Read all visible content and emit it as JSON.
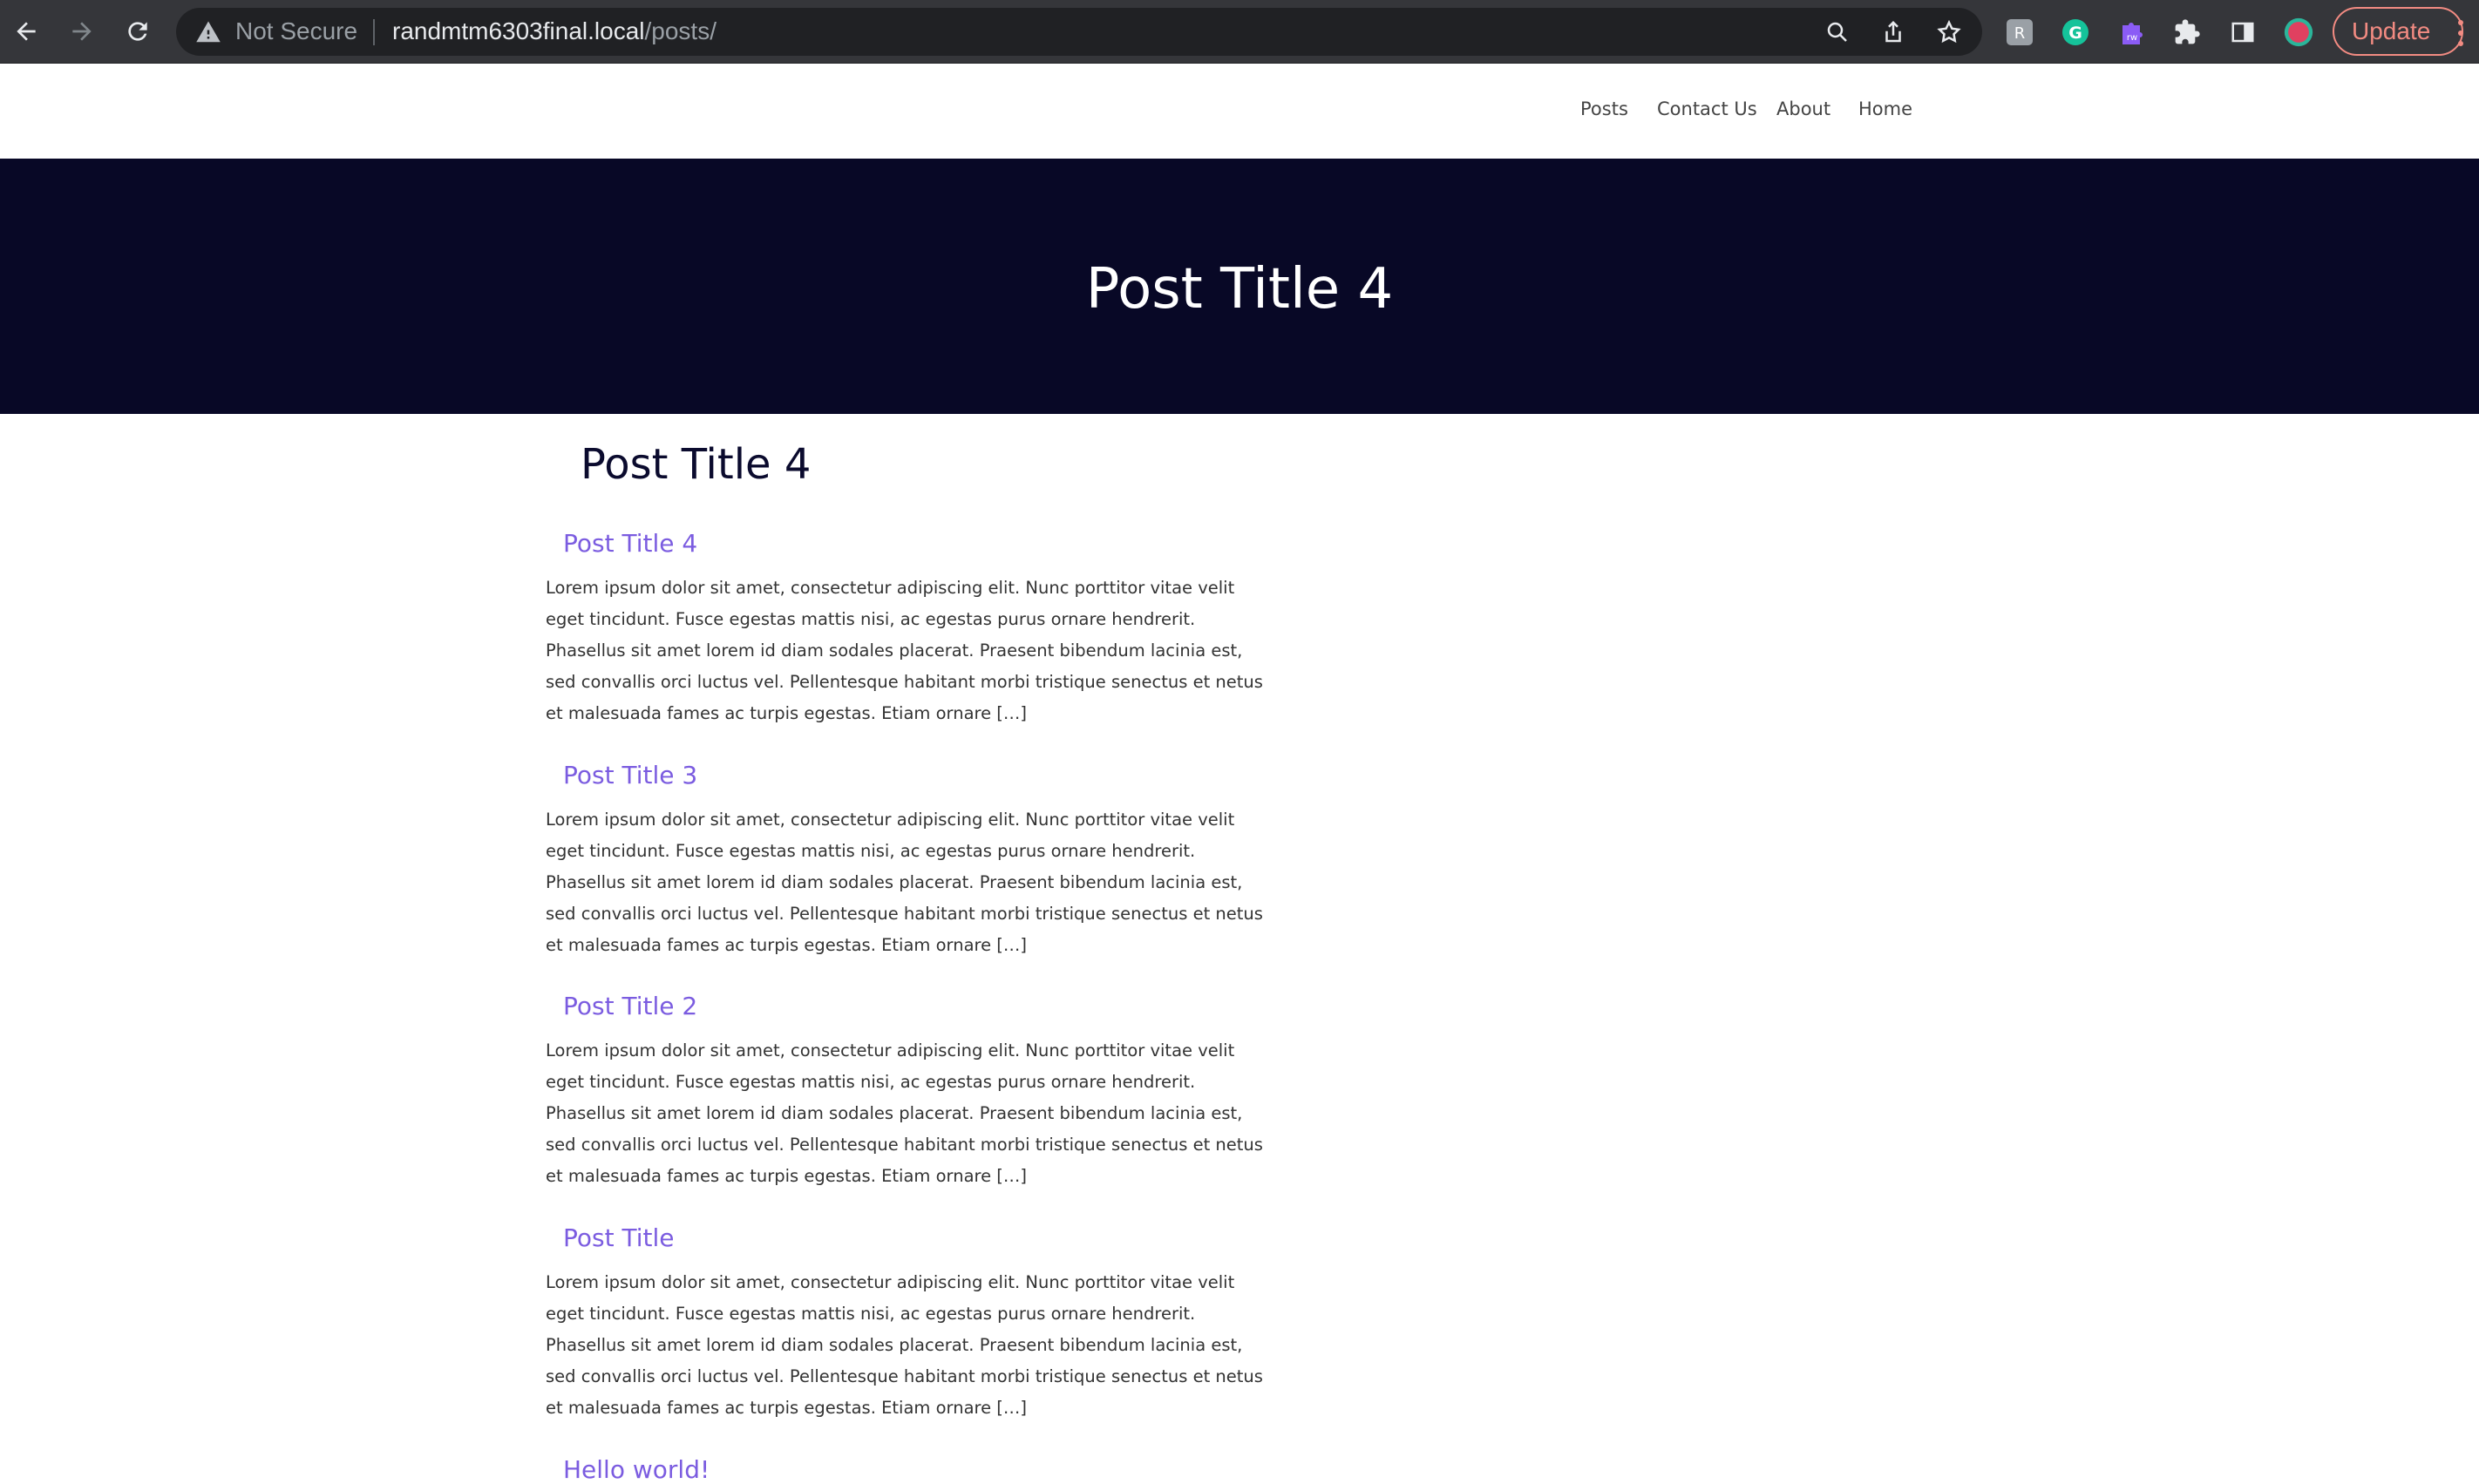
{
  "browser": {
    "security_label": "Not Secure",
    "url_host": "randmtm6303final.local",
    "url_path": "/posts/",
    "update_label": "Update"
  },
  "site": {
    "nav": [
      "Posts",
      "Contact Us",
      "About",
      "Home"
    ],
    "hero_title": "Post Title 4",
    "page_heading": "Post Title 4"
  },
  "posts": [
    {
      "title": "Post Title 4",
      "excerpt": "Lorem ipsum dolor sit amet, consectetur adipiscing elit. Nunc porttitor vitae velit eget tincidunt. Fusce egestas mattis nisi, ac egestas purus ornare hendrerit. Phasellus sit amet lorem id diam sodales placerat. Praesent bibendum lacinia est, sed convallis orci luctus vel. Pellentesque habitant morbi tristique senectus et netus et malesuada fames ac turpis egestas. Etiam ornare […]"
    },
    {
      "title": "Post Title 3",
      "excerpt": "Lorem ipsum dolor sit amet, consectetur adipiscing elit. Nunc porttitor vitae velit eget tincidunt. Fusce egestas mattis nisi, ac egestas purus ornare hendrerit. Phasellus sit amet lorem id diam sodales placerat. Praesent bibendum lacinia est, sed convallis orci luctus vel. Pellentesque habitant morbi tristique senectus et netus et malesuada fames ac turpis egestas. Etiam ornare […]"
    },
    {
      "title": "Post Title 2",
      "excerpt": "Lorem ipsum dolor sit amet, consectetur adipiscing elit. Nunc porttitor vitae velit eget tincidunt. Fusce egestas mattis nisi, ac egestas purus ornare hendrerit. Phasellus sit amet lorem id diam sodales placerat. Praesent bibendum lacinia est, sed convallis orci luctus vel. Pellentesque habitant morbi tristique senectus et netus et malesuada fames ac turpis egestas. Etiam ornare […]"
    },
    {
      "title": "Post Title",
      "excerpt": "Lorem ipsum dolor sit amet, consectetur adipiscing elit. Nunc porttitor vitae velit eget tincidunt. Fusce egestas mattis nisi, ac egestas purus ornare hendrerit. Phasellus sit amet lorem id diam sodales placerat. Praesent bibendum lacinia est, sed convallis orci luctus vel. Pellentesque habitant morbi tristique senectus et netus et malesuada fames ac turpis egestas. Etiam ornare […]"
    },
    {
      "title": "Hello world!",
      "excerpt": ""
    }
  ],
  "icons": {
    "back": "arrow-left-icon",
    "forward": "arrow-right-icon",
    "reload": "reload-icon",
    "warning": "warning-triangle-icon",
    "zoom": "magnifier-icon",
    "share": "share-icon",
    "bookmark": "star-icon",
    "extensions": [
      "extension-a-icon",
      "grammarly-icon",
      "rw-extension-icon",
      "puzzle-icon",
      "side-panel-icon",
      "profile-avatar-icon"
    ],
    "menu": "kebab-menu-icon"
  },
  "colors": {
    "hero_bg": "#080826",
    "post_link": "#7b5ce0",
    "update_accent": "#f28b82"
  }
}
